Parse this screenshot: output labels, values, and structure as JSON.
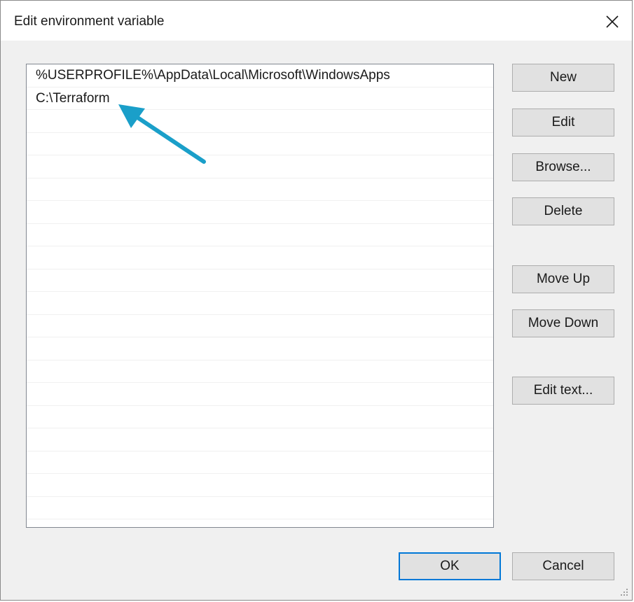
{
  "window": {
    "title": "Edit environment variable"
  },
  "entries": [
    "%USERPROFILE%\\AppData\\Local\\Microsoft\\WindowsApps",
    "C:\\Terraform",
    "",
    "",
    "",
    "",
    "",
    "",
    "",
    "",
    "",
    "",
    "",
    "",
    "",
    "",
    "",
    "",
    "",
    ""
  ],
  "buttons": {
    "new": "New",
    "edit": "Edit",
    "browse": "Browse...",
    "delete": "Delete",
    "move_up": "Move Up",
    "move_down": "Move Down",
    "edit_text": "Edit text...",
    "ok": "OK",
    "cancel": "Cancel"
  },
  "annotation": {
    "arrow_color": "#1a9fc9"
  },
  "icons": {
    "close": "close-icon",
    "arrow": "arrow-icon",
    "grip": "resize-grip-icon"
  }
}
